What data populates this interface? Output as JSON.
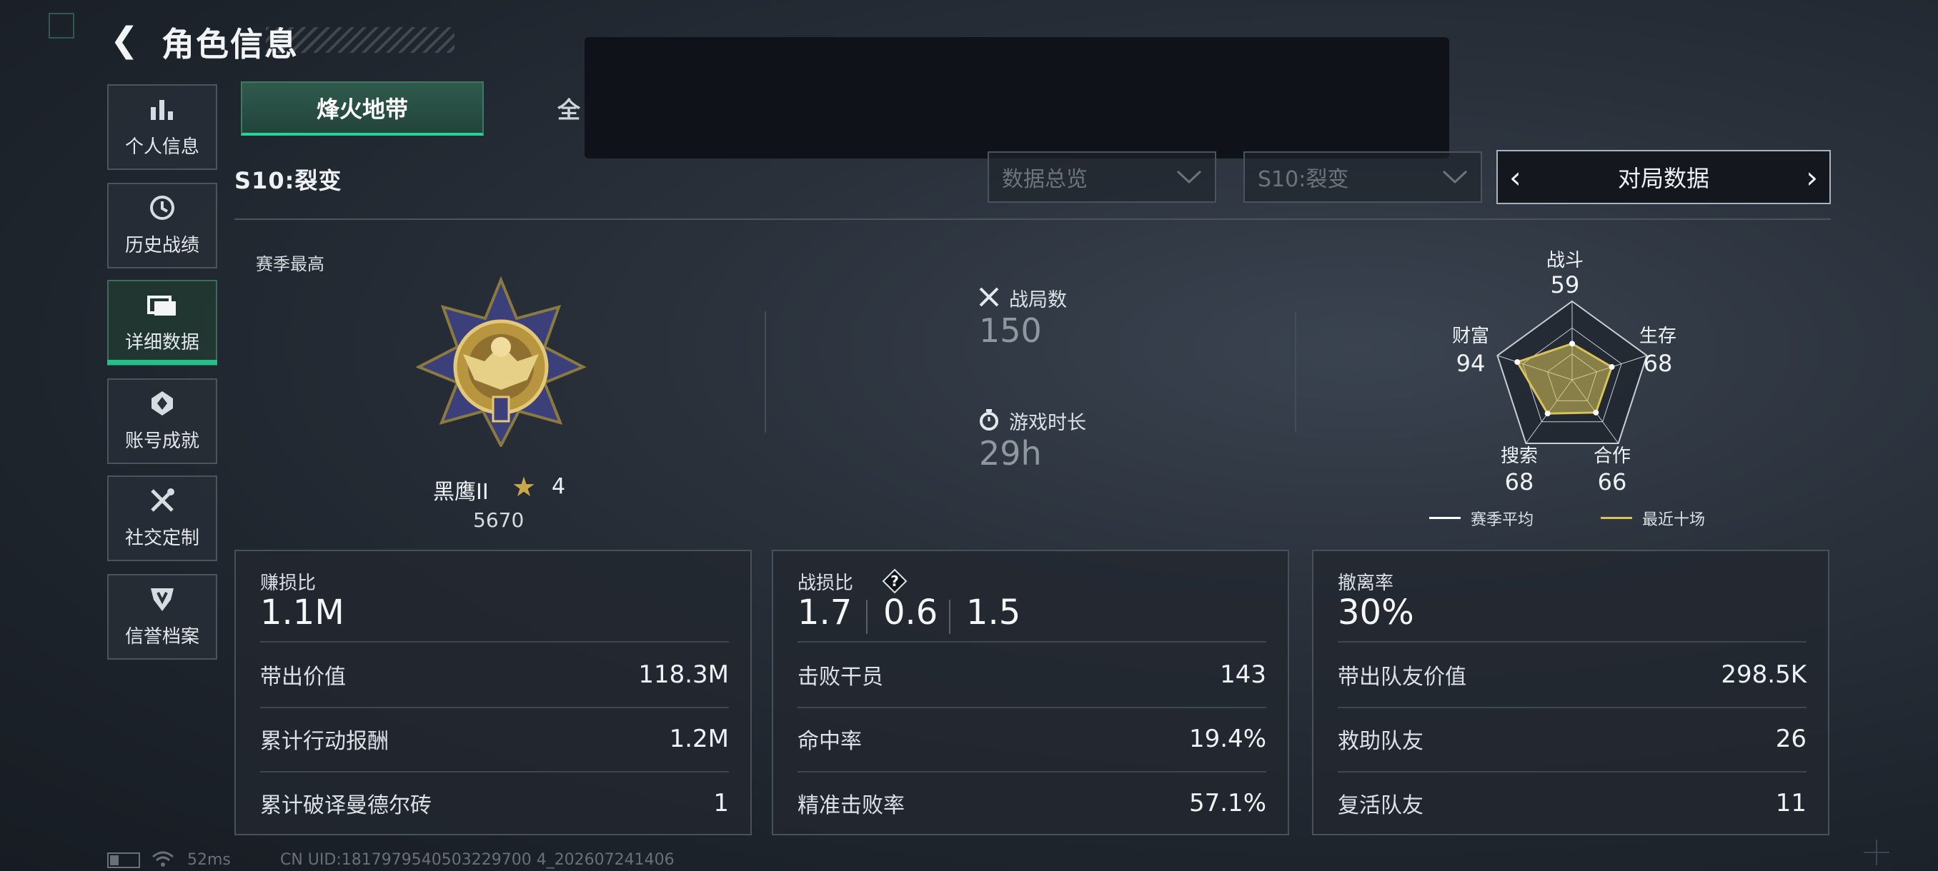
{
  "header": {
    "title": "角色信息"
  },
  "nav": {
    "items": [
      {
        "label": "个人信息",
        "icon": "bar-chart-icon"
      },
      {
        "label": "历史战绩",
        "icon": "clock-icon"
      },
      {
        "label": "详细数据",
        "icon": "folder-icon",
        "active": true
      },
      {
        "label": "账号成就",
        "icon": "achievement-icon"
      },
      {
        "label": "社交定制",
        "icon": "tools-icon"
      },
      {
        "label": "信誉档案",
        "icon": "shield-icon"
      }
    ]
  },
  "tabs": [
    {
      "label": "烽火地带",
      "active": true
    },
    {
      "label": "全"
    }
  ],
  "filters": {
    "season_label": "S10:裂变",
    "dropdown_data": "数据总览",
    "dropdown_season": "S10:裂变",
    "mode_selector": "对局数据"
  },
  "overview": {
    "season_best_label": "赛季最高",
    "rank_name": "黑鹰II",
    "rank_stars": "4",
    "rank_score": "5670",
    "battles_label": "战局数",
    "battles_value": "150",
    "playtime_label": "游戏时长",
    "playtime_value": "29h"
  },
  "radar": {
    "axes": [
      {
        "label": "战斗",
        "value": "59"
      },
      {
        "label": "生存",
        "value": "68"
      },
      {
        "label": "合作",
        "value": "66"
      },
      {
        "label": "搜索",
        "value": "68"
      },
      {
        "label": "财富",
        "value": "94"
      }
    ],
    "legend": [
      {
        "label": "赛季平均",
        "color": "#ffffff"
      },
      {
        "label": "最近十场",
        "color": "#d9c25a"
      }
    ]
  },
  "cards": {
    "profit": {
      "title": "赚损比",
      "main": "1.1M",
      "rows": [
        {
          "label": "带出价值",
          "value": "118.3M"
        },
        {
          "label": "累计行动报酬",
          "value": "1.2M"
        },
        {
          "label": "累计破译曼德尔砖",
          "value": "1"
        }
      ]
    },
    "kd": {
      "title": "战损比",
      "values": [
        "1.7",
        "0.6",
        "1.5"
      ],
      "rows": [
        {
          "label": "击败干员",
          "value": "143"
        },
        {
          "label": "命中率",
          "value": "19.4%"
        },
        {
          "label": "精准击败率",
          "value": "57.1%"
        }
      ]
    },
    "extract": {
      "title": "撤离率",
      "main": "30%",
      "rows": [
        {
          "label": "带出队友价值",
          "value": "298.5K"
        },
        {
          "label": "救助队友",
          "value": "26"
        },
        {
          "label": "复活队友",
          "value": "11"
        }
      ]
    }
  },
  "status": {
    "ping": "52ms",
    "uid": "CN UID:1817979540503229700 4_202607241406"
  },
  "colors": {
    "accent": "#2bcf98",
    "gold": "#c9a84a"
  }
}
